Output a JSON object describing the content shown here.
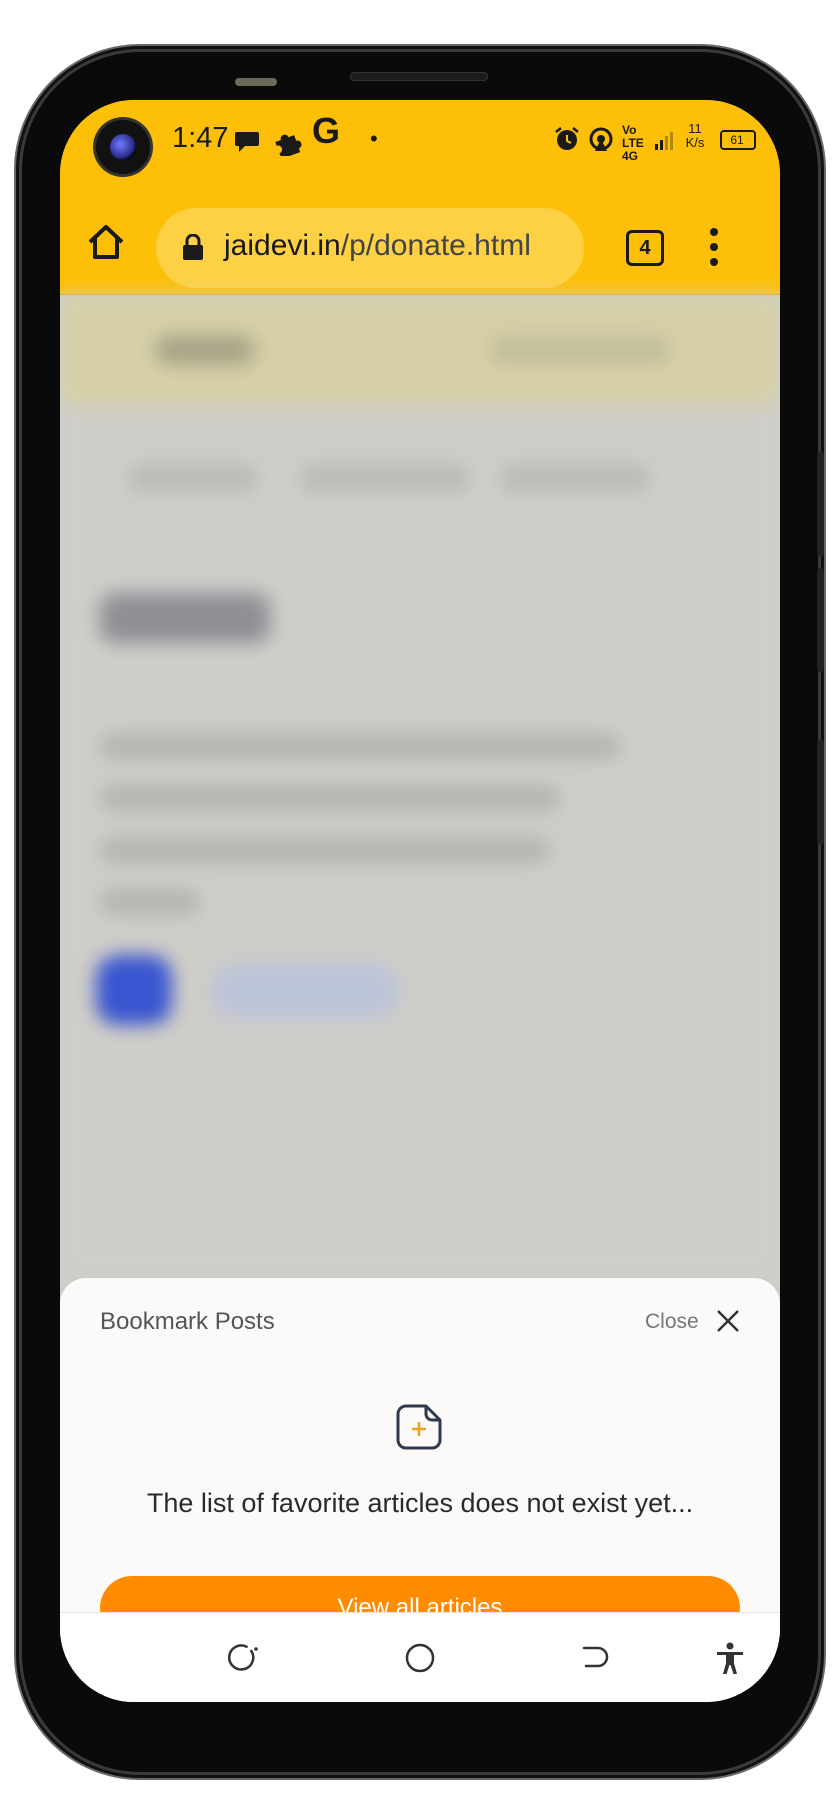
{
  "status_bar": {
    "time": "1:47",
    "google_g": "G",
    "dot": "•",
    "network": "Vo LTE 4G",
    "speed_value": "11",
    "speed_unit": "K/s",
    "battery": "61",
    "icons": [
      "chat-icon",
      "puzzle-icon",
      "alarm-icon",
      "hotspot-icon",
      "signal-icon",
      "battery-icon"
    ]
  },
  "browser": {
    "url_domain": "jaidevi.in",
    "url_path": "/p/donate.html",
    "tab_count": "4"
  },
  "bookmark_sheet": {
    "title": "Bookmark Posts",
    "close_label": "Close",
    "empty_message": "The list of favorite articles does not exist yet...",
    "button_label": "View all articles"
  },
  "colors": {
    "chrome_yellow": "#fdbf08",
    "accent_orange": "#ff8c00",
    "sheet_bg": "#fbfaf8"
  }
}
